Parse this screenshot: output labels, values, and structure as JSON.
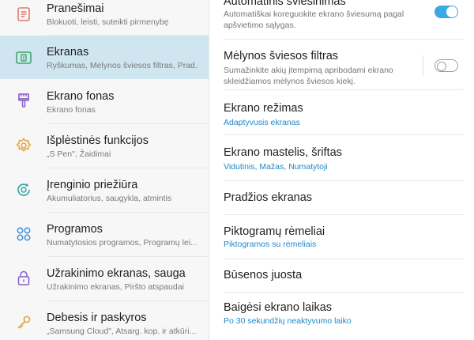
{
  "sidebar": {
    "items": [
      {
        "title": "Pranešimai",
        "sub": "Blokuoti, leisti, suteikti pirmenybę",
        "icon": "notifications-icon",
        "active": false
      },
      {
        "title": "Ekranas",
        "sub": "Ryškumas, Mėlynos šviesos filtras, Prad...",
        "icon": "display-icon",
        "active": true
      },
      {
        "title": "Ekrano fonas",
        "sub": "Ekrano fonas",
        "icon": "wallpaper-brush-icon",
        "active": false
      },
      {
        "title": "Išplėstinės funkcijos",
        "sub": "„S Pen\", Žaidimai",
        "icon": "advanced-features-gear-icon",
        "active": false
      },
      {
        "title": "Įrenginio priežiūra",
        "sub": "Akumuliatorius, saugykla, atmintis",
        "icon": "device-care-icon",
        "active": false
      },
      {
        "title": "Programos",
        "sub": "Numatytosios programos, Programų lei...",
        "icon": "apps-icon",
        "active": false
      },
      {
        "title": "Užrakinimo ekranas, sauga",
        "sub": "Užrakinimo ekranas, Piršto atspaudai",
        "icon": "lock-icon",
        "active": false
      },
      {
        "title": "Debesis ir paskyros",
        "sub": "„Samsung Cloud\", Atsarg. kop. ir atkūri...",
        "icon": "key-icon",
        "active": false
      }
    ]
  },
  "settings": {
    "auto_brightness": {
      "title": "Automatinis šviesinimas",
      "sub": "Automatiškai koreguokite ekrano šviesumą pagal apšvietimo sąlygas.",
      "enabled": true
    },
    "blue_light": {
      "title": "Mėlynos šviesos filtras",
      "sub": "Sumažinkite akių įtempimą apribodami ekrano skleidžiamos mėlynos šviesos kiekį.",
      "enabled": false
    },
    "screen_mode": {
      "title": "Ekrano režimas",
      "value": "Adaptyvusis ekranas"
    },
    "zoom_font": {
      "title": "Ekrano mastelis, šriftas",
      "value": "Vidutinis, Mažas, Numatytoji"
    },
    "home_screen": {
      "title": "Pradžios ekranas"
    },
    "icon_frames": {
      "title": "Piktogramų rėmeliai",
      "value": "Piktogramos su rėmeliais"
    },
    "status_bar": {
      "title": "Būsenos juosta"
    },
    "screen_timeout": {
      "title": "Baigėsi ekrano laikas",
      "value": "Po 30 sekundžių neaktyvumo laiko"
    }
  },
  "colors": {
    "accent": "#3aa9e6",
    "active_bg": "#cfe6f0",
    "link_blue": "#1f88c9"
  }
}
